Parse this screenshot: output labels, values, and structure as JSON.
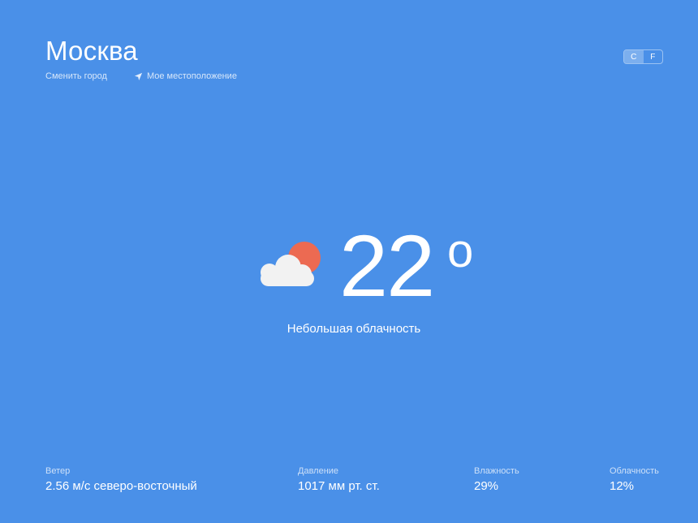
{
  "header": {
    "city": "Москва",
    "change_city": "Сменить город",
    "my_location": "Мое местоположение"
  },
  "units": {
    "celsius": "C",
    "fahrenheit": "F",
    "active": "C"
  },
  "current": {
    "temperature": "22",
    "degree_symbol": "o",
    "description": "Небольшая облачность",
    "icon": "partly-cloudy-icon"
  },
  "details": [
    {
      "label": "Ветер",
      "value": "2.56 м/с северо-восточный"
    },
    {
      "label": "Давление",
      "value": "1017 мм рт. ст."
    },
    {
      "label": "Влажность",
      "value": "29%"
    },
    {
      "label": "Облачность",
      "value": "12%"
    }
  ],
  "colors": {
    "background": "#4a90e8",
    "sun": "#ec6a52",
    "cloud": "#f2f2f2",
    "text": "#ffffff"
  }
}
